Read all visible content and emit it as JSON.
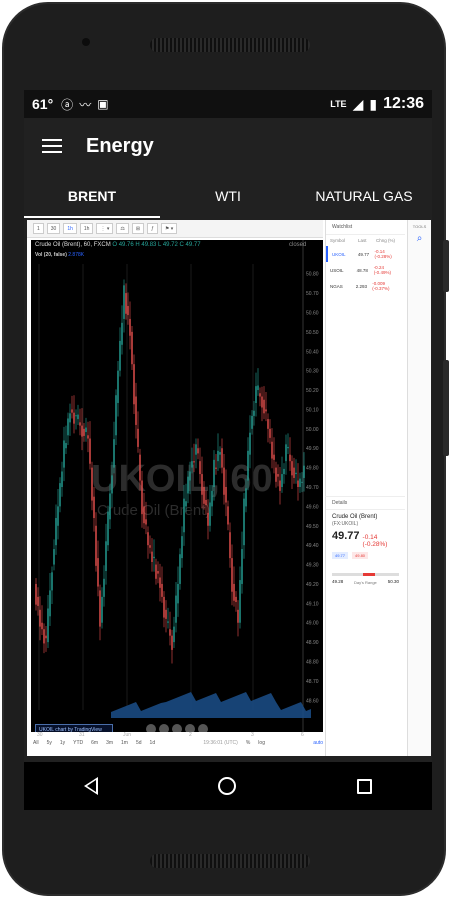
{
  "status": {
    "temperature": "61°",
    "network": "LTE",
    "time": "12:36",
    "icons": [
      "weather-app-icon",
      "wave-icon",
      "android-icon",
      "signal-icon",
      "battery-icon"
    ]
  },
  "appbar": {
    "title": "Energy",
    "menu_icon": "hamburger-menu-icon"
  },
  "tabs": [
    {
      "label": "BRENT",
      "active": true
    },
    {
      "label": "WTI",
      "active": false
    },
    {
      "label": "NATURAL GAS",
      "active": false
    }
  ],
  "chart": {
    "toolbar": [
      "1",
      "30",
      "1h",
      "1h",
      "⋮ ▾",
      "⚖",
      "⊞",
      "ƒ",
      "⚑ ▾"
    ],
    "legend": {
      "symbol": "Crude Oil (Brent), 60, FXCM",
      "ohlc": "O 49.76  H 49.83  L 49.72  C 49.77",
      "closed": "closed"
    },
    "volume": "Vol (20, false)",
    "volume_value": "2.878K",
    "watermark_symbol": "UKOIL, 60",
    "watermark_name": "Crude Oil (Brent)",
    "powered_by": "UKOIL chart by TradingView",
    "x_labels": [
      "30",
      "31",
      "Jun",
      "2",
      "3",
      "6"
    ],
    "timeframes": [
      "All",
      "5y",
      "1y",
      "YTD",
      "6m",
      "3m",
      "1m",
      "5d",
      "1d"
    ],
    "time_info": "19:36:01 (UTC)",
    "scale_opts": [
      "%",
      "log",
      "auto"
    ],
    "y_ticks": [
      "50.80",
      "50.70",
      "50.60",
      "50.50",
      "50.40",
      "50.30",
      "50.20",
      "50.10",
      "50.00",
      "49.90",
      "49.80",
      "49.70",
      "49.60",
      "49.50",
      "49.40",
      "49.30",
      "49.20",
      "49.10",
      "49.00",
      "48.90",
      "48.80",
      "48.70",
      "48.60"
    ]
  },
  "chart_data": {
    "type": "candlestick",
    "title": "Crude Oil (Brent), 60, FXCM",
    "ylim": [
      48.55,
      50.85
    ],
    "x_labels": [
      "30",
      "31",
      "Jun",
      "2",
      "3",
      "6"
    ],
    "close": [
      49.2,
      49.0,
      48.9,
      49.3,
      49.6,
      49.9,
      50.1,
      50.05,
      50.0,
      49.95,
      49.5,
      49.0,
      49.4,
      49.8,
      50.3,
      50.7,
      50.5,
      50.0,
      49.6,
      49.4,
      49.3,
      49.2,
      49.0,
      48.9,
      49.2,
      49.6,
      49.8,
      49.9,
      49.7,
      49.5,
      49.8,
      49.9,
      49.6,
      49.2,
      49.0,
      49.6,
      50.0,
      50.2,
      50.15,
      50.0,
      49.8,
      49.7,
      49.9,
      49.8,
      49.7,
      49.77
    ]
  },
  "watchlist": {
    "title": "Watchlist",
    "headers": [
      "Symbol",
      "Last",
      "Chng (%)"
    ],
    "rows": [
      {
        "symbol": "UKOIL",
        "last": "49.77",
        "change": "-0.14 (-0.28%)"
      },
      {
        "symbol": "USOIL",
        "last": "48.78",
        "change": "-0.24 (-0.49%)"
      },
      {
        "symbol": "NGAS",
        "last": "2.293",
        "change": "-0.009 (-0.37%)"
      }
    ]
  },
  "details": {
    "title": "Details",
    "name": "Crude Oil (Brent)",
    "exchange": "(FX:UKOIL)",
    "price": "49.77",
    "change": "-0.14 (-0.28%)",
    "bid": "49.77",
    "ask": "49.80",
    "range_low": "49.28",
    "range_high": "50.30",
    "range_label": "Day's Range"
  },
  "tools_label": "TOOLS",
  "colors": {
    "up": "#26a69a",
    "down": "#ef5350",
    "accent": "#2962ff"
  }
}
